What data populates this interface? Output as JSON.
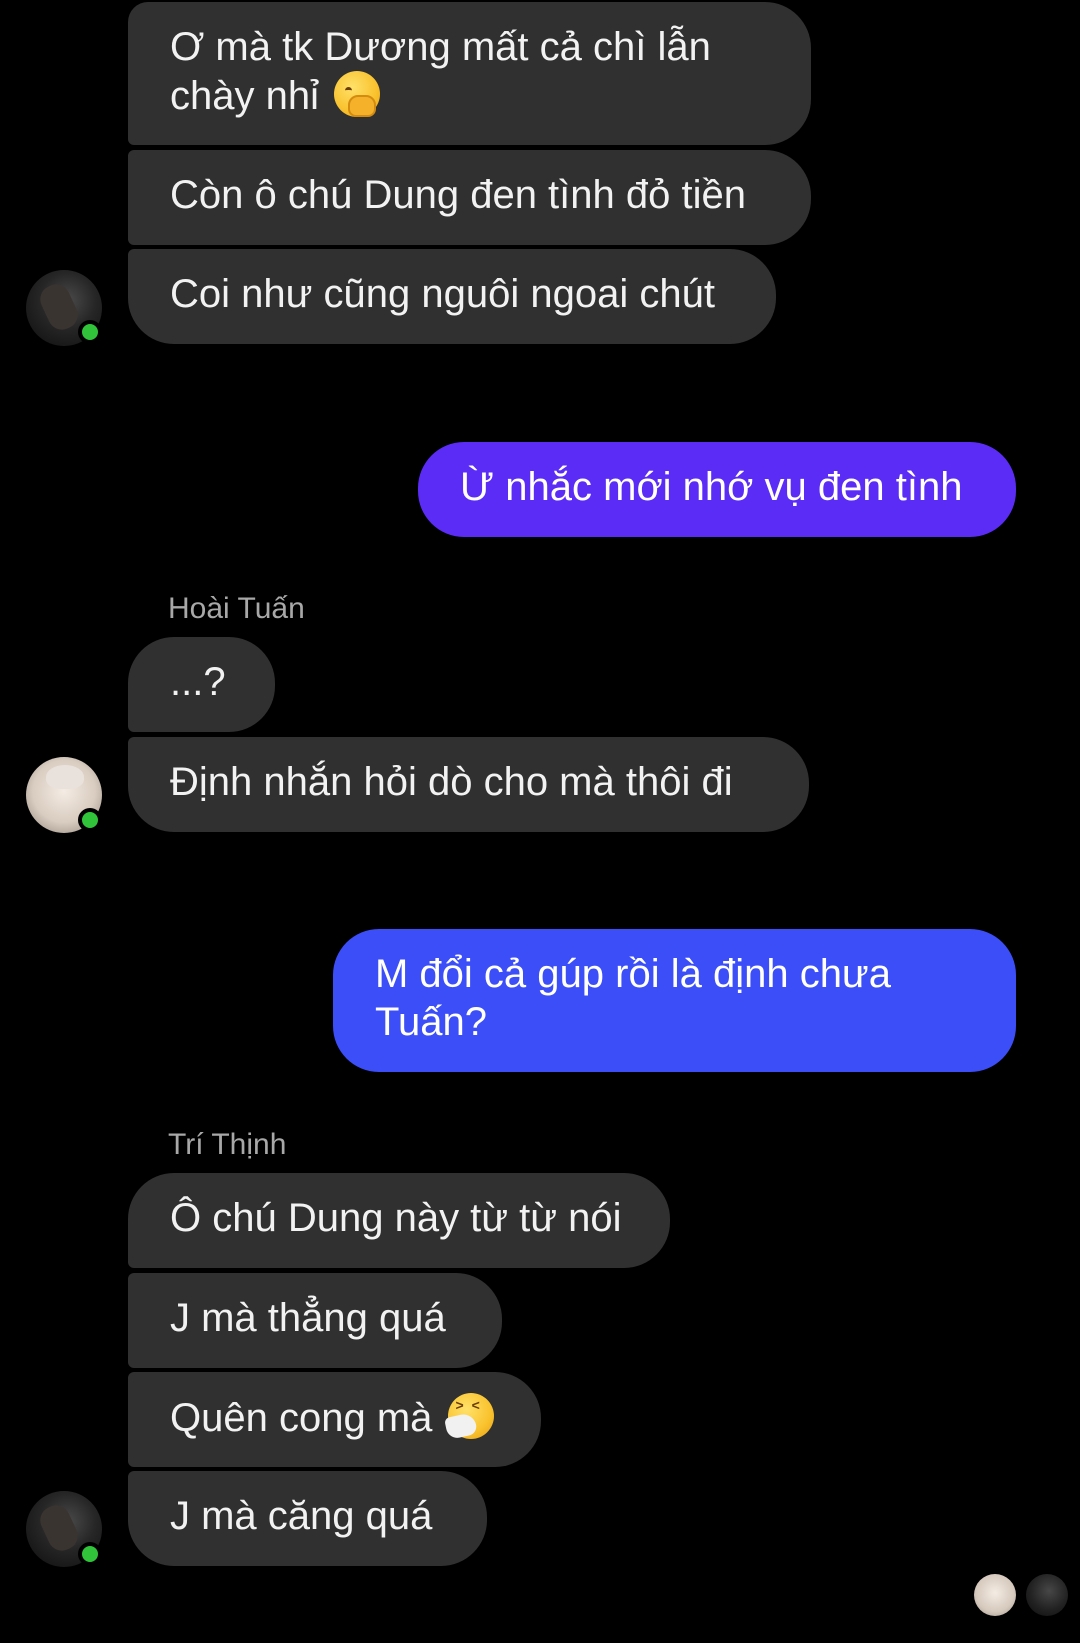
{
  "conversation": {
    "groups": [
      {
        "messages": [
          {
            "text": "Ơ mà tk Dương mất cả chì lẫn"
          },
          {
            "text": "chày nhỉ",
            "emoji": "hand-over-mouth-emoji"
          },
          {
            "text": "Còn ô chú Dung đen tình đỏ tiền"
          },
          {
            "text": "Coi như cũng nguôi ngoai chút"
          }
        ]
      },
      {
        "outgoing": true,
        "messages": [
          {
            "text": "Ừ nhắc mới nhớ vụ đen tình"
          }
        ]
      },
      {
        "sender": "Hoài Tuấn",
        "messages": [
          {
            "text": "...?"
          },
          {
            "text": "Định nhắn hỏi dò cho mà thôi đi"
          }
        ]
      },
      {
        "outgoing": true,
        "messages": [
          {
            "text": "M đổi cả gúp rồi là định chưa"
          },
          {
            "text": "Tuấn?"
          }
        ]
      },
      {
        "sender": "Trí Thịnh",
        "messages": [
          {
            "text": "Ô chú Dung này từ từ nói"
          },
          {
            "text": "J mà thẳng quá"
          },
          {
            "text": "Quên cong mà",
            "emoji": "sneezing-face-emoji"
          },
          {
            "text": "J mà căng quá"
          }
        ]
      }
    ]
  },
  "colors": {
    "background": "#000000",
    "incoming_bubble": "#303030",
    "outgoing_bubble_top": "#5b2cf5",
    "outgoing_bubble_bottom": "#3b4ef7",
    "online_dot": "#31c43a",
    "sender_name": "#a8a8a8"
  }
}
